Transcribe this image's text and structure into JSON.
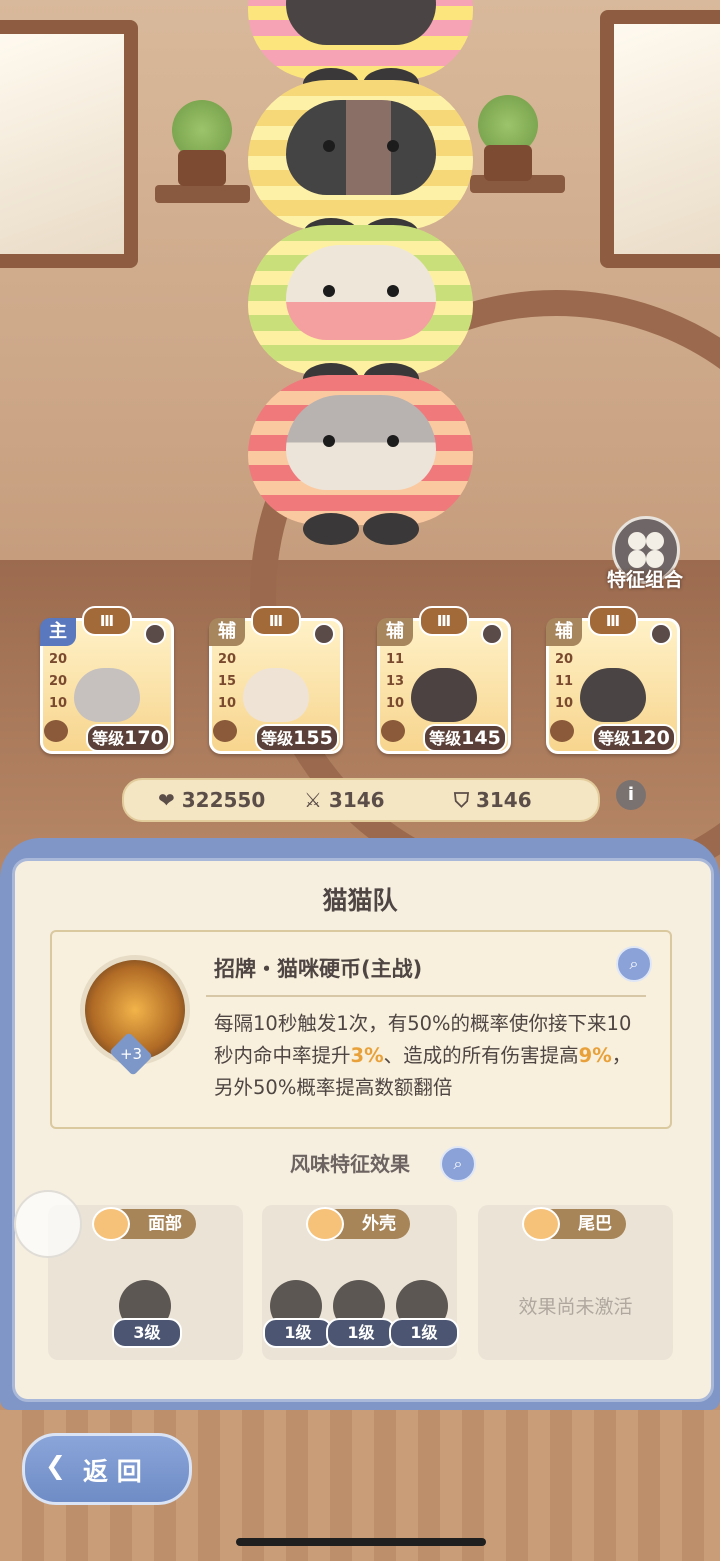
{
  "trait_combo": {
    "label": "特征组合"
  },
  "team": [
    {
      "role": "主",
      "role_color": "#5a78bd",
      "rank": "Ⅲ",
      "stats": [
        "20",
        "20",
        "10"
      ],
      "level_prefix": "等级",
      "level": "170",
      "body": "#f08a8f",
      "face": "#c6c1bf"
    },
    {
      "role": "辅",
      "role_color": "#a7855d",
      "rank": "Ⅲ",
      "stats": [
        "20",
        "15",
        "10"
      ],
      "level_prefix": "等级",
      "level": "155",
      "body": "#d8e27b",
      "face": "#efe3d6"
    },
    {
      "role": "辅",
      "role_color": "#a7855d",
      "rank": "Ⅲ",
      "stats": [
        "11",
        "13",
        "10"
      ],
      "level_prefix": "等级",
      "level": "145",
      "body": "#f7d980",
      "face": "#4b4241"
    },
    {
      "role": "辅",
      "role_color": "#a7855d",
      "rank": "Ⅲ",
      "stats": [
        "20",
        "11",
        "10"
      ],
      "level_prefix": "等级",
      "level": "120",
      "body": "#f3b7bf",
      "face": "#4a4544"
    }
  ],
  "totals": {
    "hp": "322550",
    "attack": "3146",
    "defense": "3146"
  },
  "panel": {
    "title": "猫猫队",
    "skill": {
      "name": "招牌・猫咪硬币(主战)",
      "plus": "+3",
      "desc_1a": "每隔10秒触发1次，有50%的概率使你接下来10秒内命中率提升",
      "desc_1b": "3%",
      "desc_2a": "、造成的所有伤害提高",
      "desc_2b": "9%",
      "desc_2c": "，另外50%概率提高数额翻倍"
    },
    "flavor_title": "风味特征效果",
    "parts": [
      {
        "name": "面部",
        "gems": [
          "3级"
        ]
      },
      {
        "name": "外壳",
        "gems": [
          "1级",
          "1级",
          "1级"
        ]
      },
      {
        "name": "尾巴",
        "inactive": "效果尚未激活"
      }
    ]
  },
  "back": {
    "label": "返 回"
  }
}
